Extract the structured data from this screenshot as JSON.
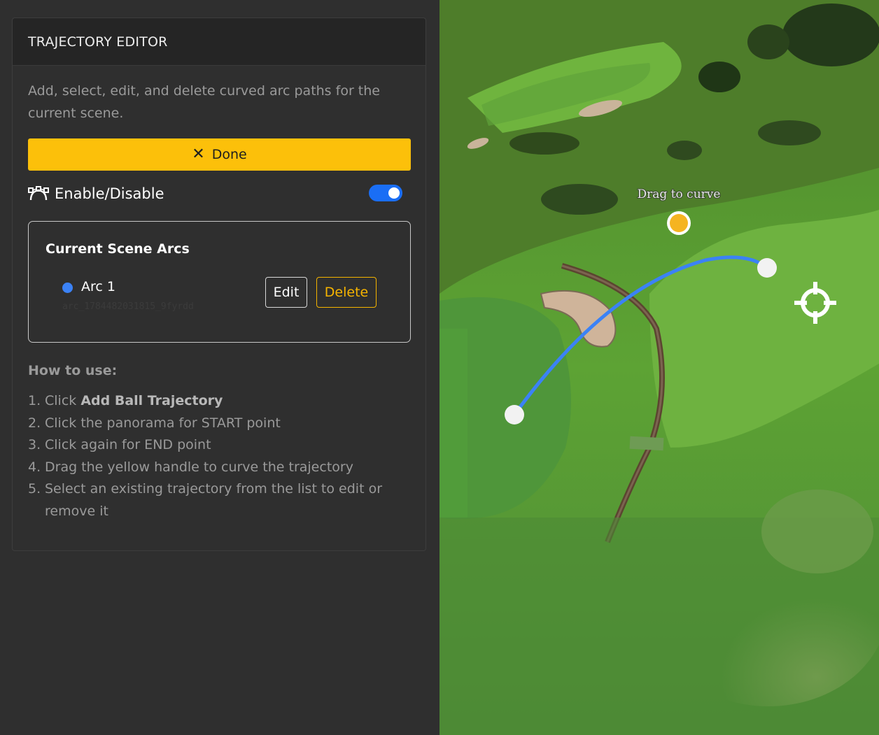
{
  "panel": {
    "title": "TRAJECTORY EDITOR",
    "description": "Add, select, edit, and delete curved arc paths for the current scene.",
    "done_label": "Done",
    "toggle_label": "Enable/Disable",
    "toggle_on": true
  },
  "arcs": {
    "title": "Current Scene Arcs",
    "items": [
      {
        "name": "Arc 1",
        "id": "arc_1784482031815_9fyrdd",
        "color": "#3b82f6",
        "edit_label": "Edit",
        "delete_label": "Delete"
      }
    ]
  },
  "howto": {
    "title": "How to use:",
    "steps": [
      {
        "num": "1.",
        "pre": "Click ",
        "bold": "Add Ball Trajectory",
        "post": ""
      },
      {
        "num": "2.",
        "pre": "Click the panorama for START point",
        "bold": "",
        "post": ""
      },
      {
        "num": "3.",
        "pre": "Click again for END point",
        "bold": "",
        "post": ""
      },
      {
        "num": "4.",
        "pre": "Drag the yellow handle to curve the trajectory",
        "bold": "",
        "post": ""
      },
      {
        "num": "5.",
        "pre": "Select an existing trajectory from the list to edit or remove it",
        "bold": "",
        "post": ""
      }
    ]
  },
  "scene": {
    "drag_hint": "Drag to curve",
    "arc_color": "#3b82f6",
    "handle_color": "#f5b421"
  },
  "colors": {
    "accent": "#fcc00a",
    "toggle": "#1a6ef5"
  }
}
